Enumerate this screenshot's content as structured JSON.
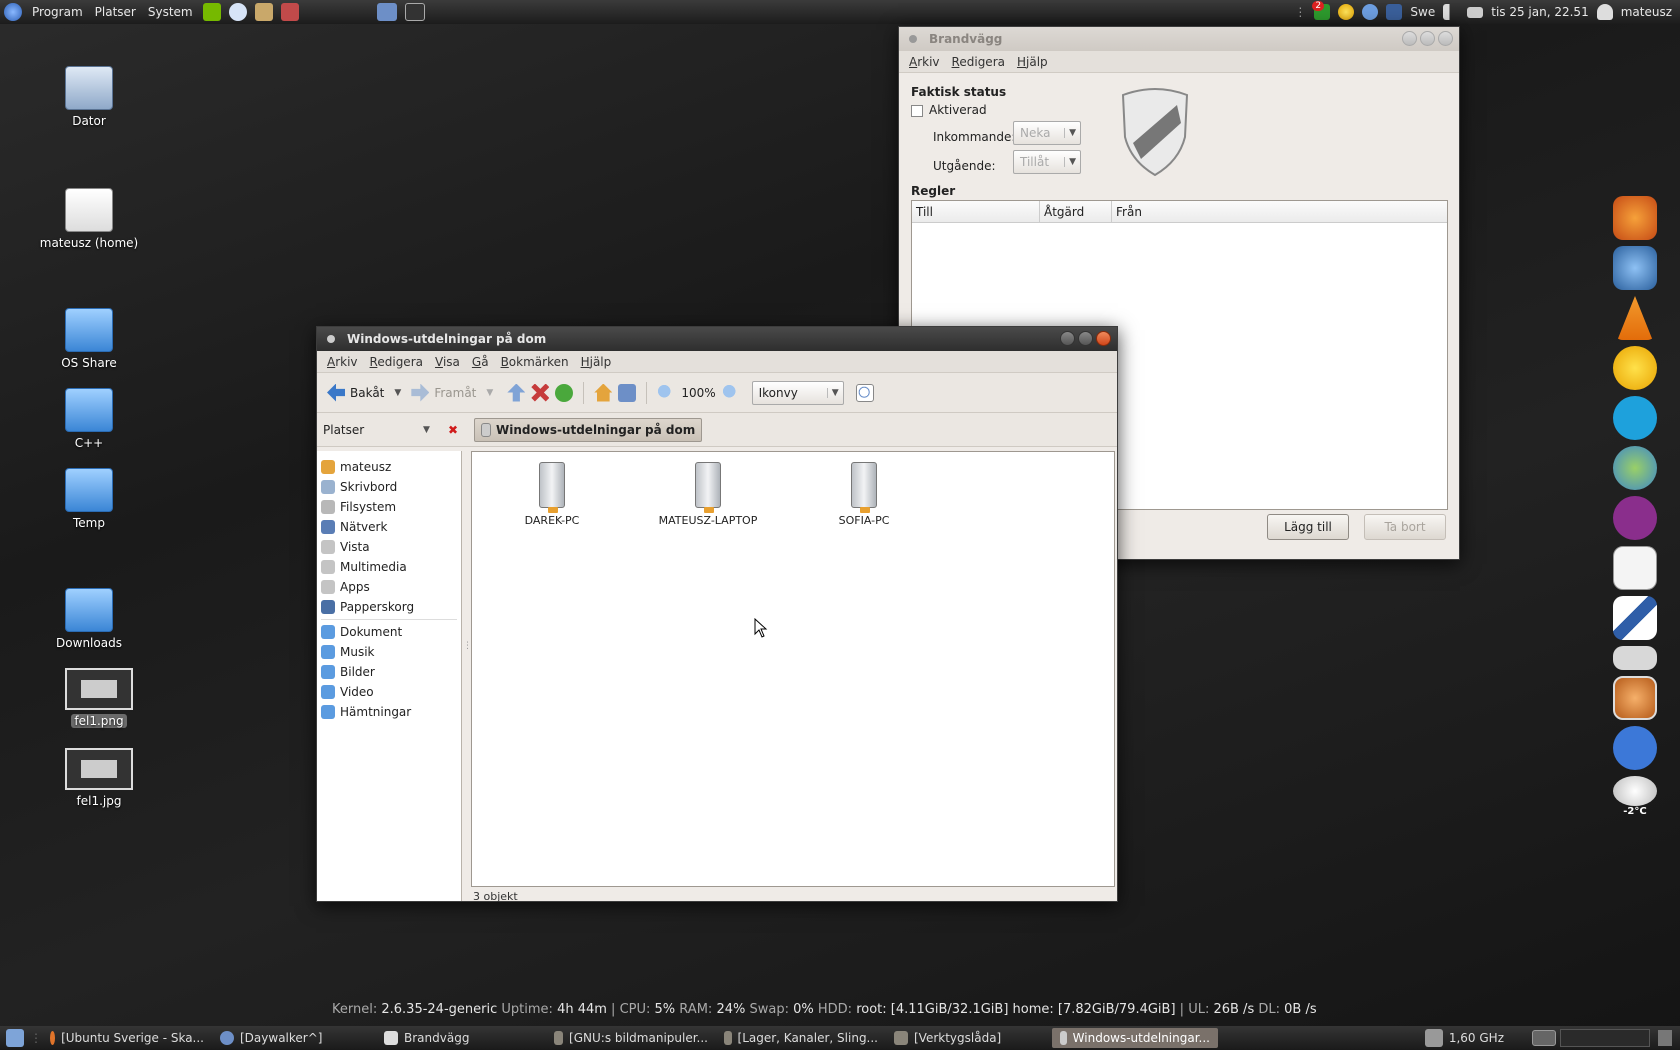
{
  "topbar": {
    "menus": [
      "Program",
      "Platser",
      "System"
    ],
    "keyboard": "Swe",
    "clock": "tis 25 jan, 22.51",
    "user": "mateusz",
    "notification_count": "2"
  },
  "desktop": {
    "icons": [
      "Dator",
      "mateusz (home)",
      "OS Share",
      "C++",
      "Temp",
      "Downloads",
      "fel1.png",
      "fel1.jpg"
    ]
  },
  "firewall": {
    "title": "Brandvägg",
    "menu": [
      "Arkiv",
      "Redigera",
      "Hjälp"
    ],
    "status_heading": "Faktisk status",
    "enabled_label": "Aktiverad",
    "incoming_label": "Inkommande:",
    "incoming_value": "Neka",
    "outgoing_label": "Utgående:",
    "outgoing_value": "Tillåt",
    "rules_heading": "Regler",
    "columns": [
      "Till",
      "Åtgärd",
      "Från"
    ],
    "add_button": "Lägg till",
    "remove_button": "Ta bort"
  },
  "nautilus": {
    "title": "Windows-utdelningar på dom",
    "menu": [
      "Arkiv",
      "Redigera",
      "Visa",
      "Gå",
      "Bokmärken",
      "Hjälp"
    ],
    "back": "Bakåt",
    "forward": "Framåt",
    "zoom": "100%",
    "view_mode": "Ikonvy",
    "sidebar_title": "Platser",
    "breadcrumb": "Windows-utdelningar på dom",
    "places": [
      "mateusz",
      "Skrivbord",
      "Filsystem",
      "Nätverk",
      "Vista",
      "Multimedia",
      "Apps",
      "Papperskorg"
    ],
    "bookmarks": [
      "Dokument",
      "Musik",
      "Bilder",
      "Video",
      "Hämtningar"
    ],
    "items": [
      "DAREK-PC",
      "MATEUSZ-LAPTOP",
      "SOFIA-PC"
    ],
    "status": "3 objekt"
  },
  "conky": {
    "kernel_label": "Kernel:",
    "kernel": "2.6.35-24-generic",
    "uptime_label": "Uptime:",
    "uptime": "4h 44m",
    "cpu_label": "CPU:",
    "cpu": "5%",
    "ram_label": "RAM:",
    "ram": "24%",
    "swap_label": "Swap:",
    "swap": "0%",
    "hdd_label": "HDD:",
    "hdd": "root: [4.11GiB/32.1GiB] home: [7.82GiB/79.4GiB]",
    "ul_label": "UL:",
    "ul": "26B  /s",
    "dl_label": "DL:",
    "dl": "0B  /s"
  },
  "taskbar": {
    "tasks": [
      "[Ubuntu Sverige - Ska...",
      "[Daywalker^]",
      "Brandvägg",
      "[GNU:s bildmanipuler...",
      "[Lager, Kanaler, Sling...",
      "[Verktygslåda]",
      "Windows-utdelningar..."
    ],
    "cpu_freq": "1,60 GHz"
  },
  "weather": "-2°C"
}
